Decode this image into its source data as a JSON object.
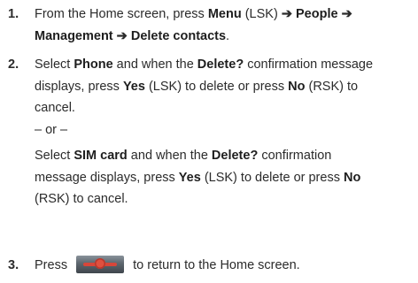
{
  "steps": [
    {
      "number": "1.",
      "parts": {
        "t1": "From the Home screen, press ",
        "menu": "Menu",
        "t2": " (LSK) ",
        "people": "People",
        "management": "Management",
        "delete_contacts": "Delete contacts",
        "t3": "."
      }
    },
    {
      "number": "2.",
      "parts": {
        "t1": "Select ",
        "phone": "Phone",
        "t2": " and when the ",
        "delete_q": "Delete?",
        "t3": " confirmation message",
        "t4": "displays, press ",
        "yes": "Yes",
        "t5": " (LSK) to delete or press ",
        "no": "No",
        "t6": " (RSK) to",
        "t7": "cancel.",
        "or": "– or –",
        "t8": "Select ",
        "sim_card": "SIM card",
        "t9": " and when the ",
        "delete_q2": "Delete?",
        "t10": " confirmation",
        "t11": "message displays, press ",
        "yes2": "Yes",
        "t12": " (LSK) to delete or press ",
        "no2": "No",
        "t13": "(RSK) to cancel."
      }
    },
    {
      "number": "3.",
      "parts": {
        "t1": "Press ",
        "t2": " to return to the Home screen."
      },
      "icon": "end-key-icon"
    }
  ],
  "arrow_glyph": "➔",
  "colors": {
    "text": "#2b2b2b",
    "end_key_red": "#d8463a",
    "end_key_gray": "#5d666e"
  }
}
